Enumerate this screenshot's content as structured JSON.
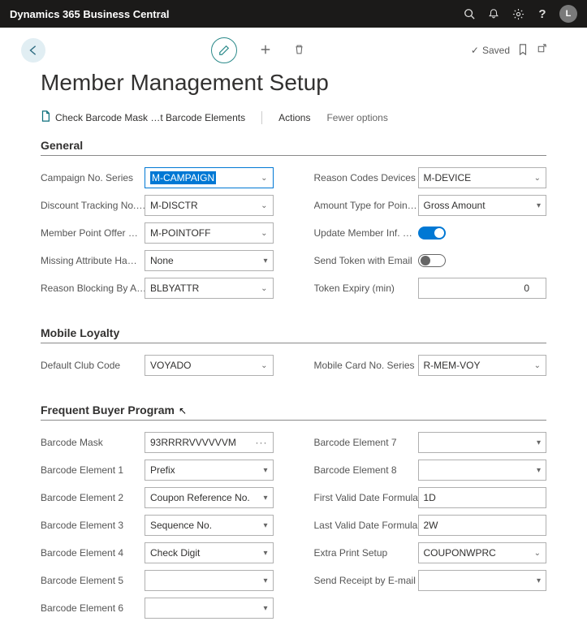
{
  "app": {
    "title": "Dynamics 365 Business Central",
    "user_initial": "L"
  },
  "status": {
    "saved_label": "Saved"
  },
  "page_title": "Member Management Setup",
  "commands": {
    "check_barcode": "Check Barcode Mask …t Barcode Elements",
    "actions": "Actions",
    "fewer_options": "Fewer options"
  },
  "sections": {
    "general": {
      "title": "General",
      "campaign_no_series_label": "Campaign No. Series",
      "campaign_no_series_value": "M-CAMPAIGN",
      "discount_tracking_label": "Discount Tracking No.…",
      "discount_tracking_value": "M-DISCTR",
      "member_point_offer_label": "Member Point Offer …",
      "member_point_offer_value": "M-POINTOFF",
      "missing_attr_label": "Missing  Attribute Ha…",
      "missing_attr_value": "None",
      "reason_blocking_label": "Reason Blocking By A…",
      "reason_blocking_value": "BLBYATTR",
      "reason_codes_devices_label": "Reason Codes Devices",
      "reason_codes_devices_value": "M-DEVICE",
      "amount_type_label": "Amount Type for Poin…",
      "amount_type_value": "Gross Amount",
      "update_member_label": "Update Member Inf. …",
      "send_token_label": "Send Token with Email",
      "token_expiry_label": "Token Expiry (min)",
      "token_expiry_value": "0"
    },
    "mobile": {
      "title": "Mobile Loyalty",
      "default_club_label": "Default Club Code",
      "default_club_value": "VOYADO",
      "mobile_card_label": "Mobile Card No. Series",
      "mobile_card_value": "R-MEM-VOY"
    },
    "fbp": {
      "title": "Frequent Buyer Program",
      "barcode_mask_label": "Barcode Mask",
      "barcode_mask_value": "93RRRRVVVVVVM",
      "be1_label": "Barcode Element 1",
      "be1_value": "Prefix",
      "be2_label": "Barcode Element 2",
      "be2_value": "Coupon Reference No.",
      "be3_label": "Barcode Element 3",
      "be3_value": "Sequence No.",
      "be4_label": "Barcode Element 4",
      "be4_value": "Check Digit",
      "be5_label": "Barcode Element 5",
      "be5_value": "",
      "be6_label": "Barcode Element 6",
      "be6_value": "",
      "be7_label": "Barcode Element 7",
      "be7_value": "",
      "be8_label": "Barcode Element 8",
      "be8_value": "",
      "first_valid_label": "First Valid Date Formula",
      "first_valid_value": "1D",
      "last_valid_label": "Last Valid Date Formula",
      "last_valid_value": "2W",
      "extra_print_label": "Extra Print Setup",
      "extra_print_value": "COUPONWPRC",
      "send_receipt_label": "Send Receipt by E-mail",
      "send_receipt_value": ""
    }
  }
}
